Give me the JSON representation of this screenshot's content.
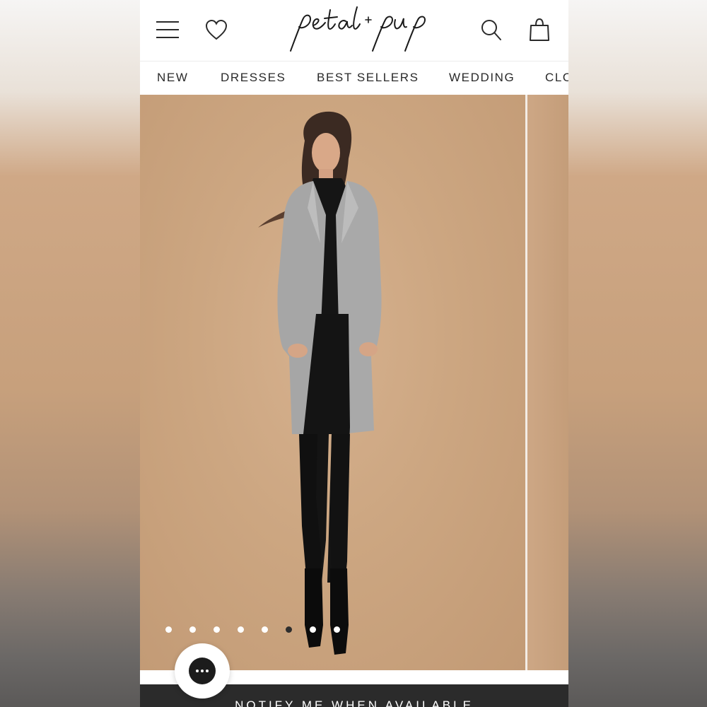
{
  "brand": {
    "logo_text": "petal + pup"
  },
  "header": {
    "icons": [
      "menu-icon",
      "heart-icon",
      "search-icon",
      "bag-icon"
    ]
  },
  "nav": {
    "items": [
      "NEW",
      "DRESSES",
      "BEST SELLERS",
      "WEDDING",
      "CLO"
    ]
  },
  "gallery": {
    "image_count": 8,
    "active_index": 5
  },
  "chat": {
    "icon": "chat-bubble-icon"
  },
  "cta": {
    "label": "NOTIFY ME WHEN AVAILABLE"
  },
  "colors": {
    "backdrop": "#c8a07c",
    "cta_bg": "#2b2b2b",
    "text": "#2a2a2a"
  }
}
